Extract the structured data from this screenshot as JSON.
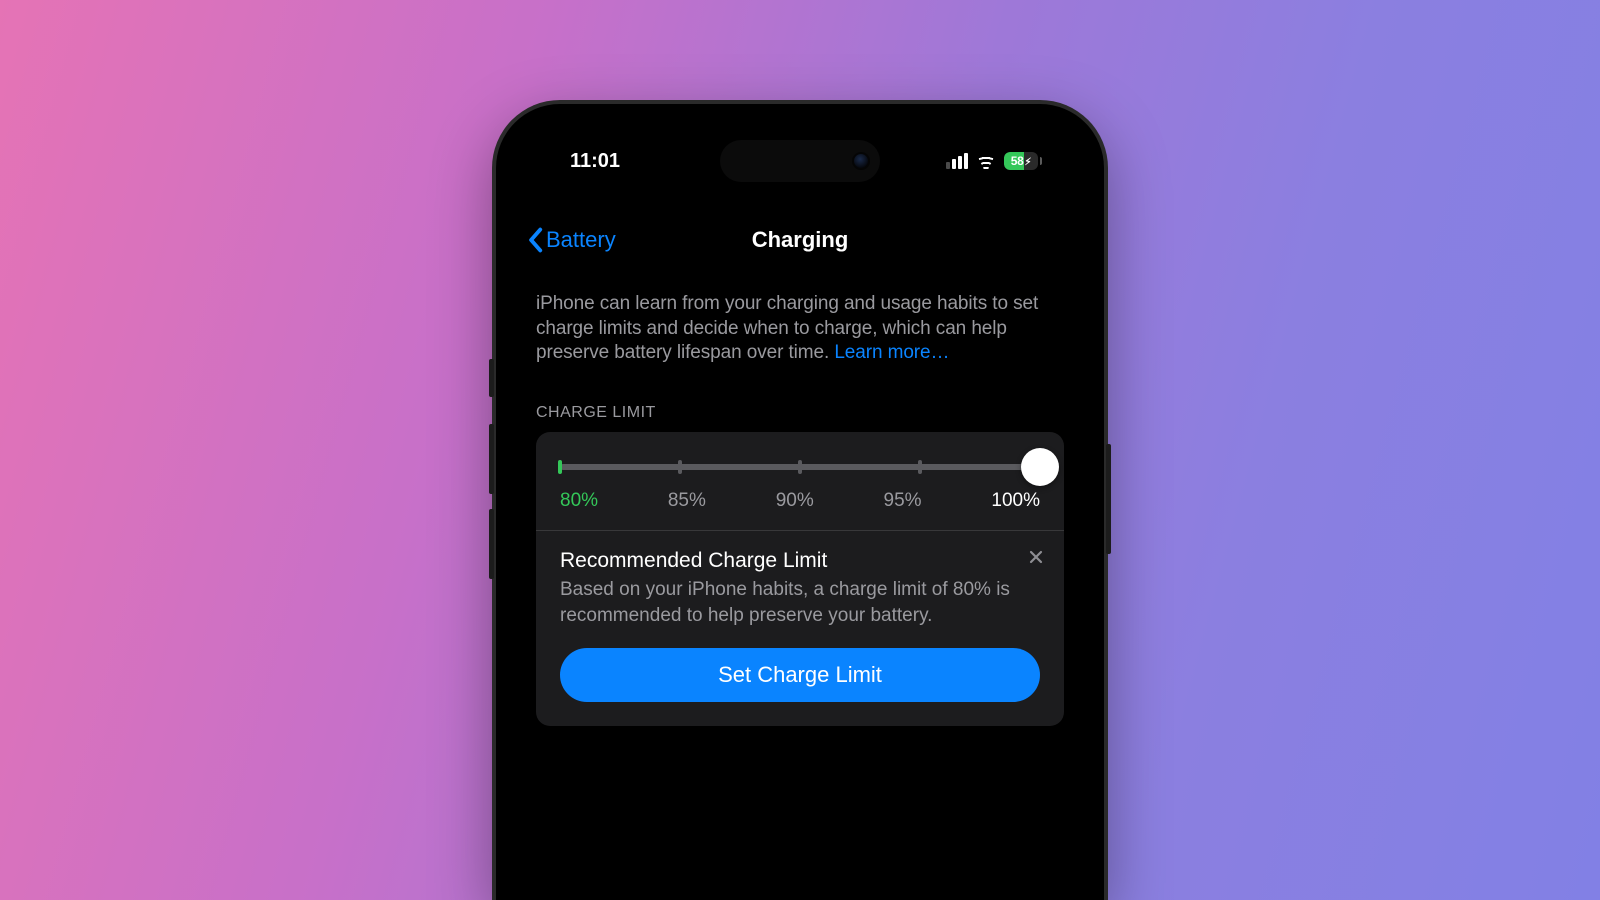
{
  "status": {
    "time": "11:01",
    "battery_percent": "58",
    "charging": true
  },
  "nav": {
    "back_label": "Battery",
    "title": "Charging"
  },
  "intro": {
    "text": "iPhone can learn from your charging and usage habits to set charge limits and decide when to charge, which can help preserve battery lifespan over time. ",
    "learn_more": "Learn more…"
  },
  "section": {
    "charge_limit_label": "CHARGE LIMIT"
  },
  "slider": {
    "recommended_index": 0,
    "current_index": 4,
    "options": [
      "80%",
      "85%",
      "90%",
      "95%",
      "100%"
    ]
  },
  "recommendation": {
    "title": "Recommended Charge Limit",
    "body": "Based on your iPhone habits, a charge limit of 80% is recommended to help preserve your battery.",
    "button": "Set Charge Limit"
  }
}
